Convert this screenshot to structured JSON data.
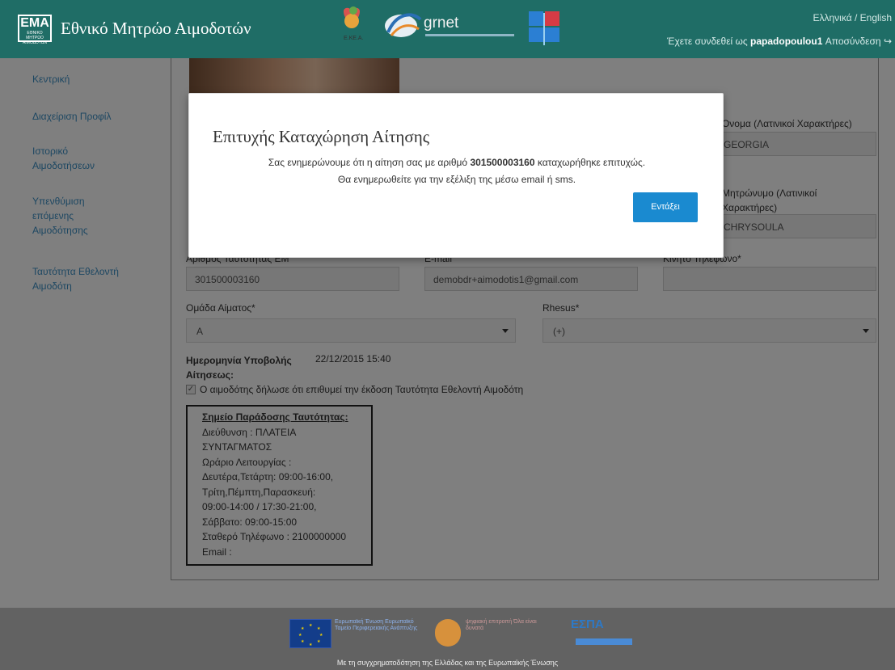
{
  "header": {
    "logo_text": "ΕΜΑ",
    "logo_sub": "ΕΘΝΙΚΟ ΜΗΤΡΩΟ ΑΙΜΟΔΟΤΩΝ",
    "title": "Εθνικό Μητρώο Αιμοδοτών",
    "partner_ekea": "Ε.ΚΕ.Α.",
    "partner_grnet": "grnet",
    "language_switch": "Ελληνικά / English",
    "logged_in_prefix": "Έχετε συνδεθεί ως",
    "username": "papadopoulou1",
    "logout_label": "Αποσύνδεση"
  },
  "sidebar": {
    "items": [
      {
        "label": "Κεντρική"
      },
      {
        "label": "Διαχείριση Προφίλ"
      },
      {
        "label": "Ιστορικό Αιμοδοτήσεων"
      },
      {
        "label": "Υπενθύμιση επόμενης Αιμοδότησης"
      },
      {
        "label": "Ταυτότητα Εθελοντή Αιμοδότη"
      }
    ]
  },
  "form": {
    "first_name_latin_label": "Όνομα (Λατινικοί Χαρακτήρες)",
    "first_name_latin_value": "GEORGIA",
    "patronymic_latin_label": "Μητρώνυμο (Λατινικοί Χαρακτήρες)",
    "patronymic_latin_value": "CHRYSOULA",
    "id_number_label": "Αριθμός Ταυτότητας ΕΜ",
    "id_number_value": "301500003160",
    "email_label": "E-mail",
    "email_value": "demobdr+aimodotis1@gmail.com",
    "mobile_label": "Κινητό Τηλέφωνο*",
    "mobile_value": "",
    "blood_group_label": "Ομάδα Αίματος*",
    "blood_group_value": "A",
    "rhesus_label": "Rhesus*",
    "rhesus_value": "(+)",
    "submission_date_label": "Ημερομηνία Υποβολής Αίτησεως:",
    "submission_date_value": "22/12/2015 15:40",
    "consent_checkbox_checked": true,
    "consent_text": "Ο αιμοδότης δήλωσε ότι επιθυμεί την έκδοση Ταυτότητα Εθελοντή Αιμοδότη"
  },
  "delivery_point": {
    "title": "Σημείο Παράδοσης Ταυτότητας:",
    "lines": [
      "Διεύθυνση : ΠΛΑΤΕΙΑ",
      "ΣΥΝΤΑΓΜΑΤΟΣ",
      "Ωράριο Λειτουργίας :",
      "Δευτέρα,Τετάρτη: 09:00-16:00,",
      "Τρίτη,Πέμπτη,Παρασκευή:",
      "09:00-14:00 / 17:30-21:00,",
      "Σάββατο: 09:00-15:00",
      "Σταθερό Τηλέφωνο : 2100000000",
      "Email :"
    ]
  },
  "modal": {
    "title": "Επιτυχής Καταχώρηση Αίτησης",
    "line1_prefix": "Σας ενημερώνουμε ότι η αίτηση σας με αριθμό",
    "line1_number": "301500003160",
    "line1_suffix": "καταχωρήθηκε επιτυχώς.",
    "line2": "Θα ενημερωθείτε για την εξέλιξη της μέσω email ή sms.",
    "ok_button": "Εντάξει"
  },
  "footer": {
    "eu_text": "Ευρωπαϊκή Ένωση Ευρωπαϊκό Ταμείο Περιφερειακής Ανάπτυξης",
    "digital_text": "ψηφιακή επιτροπή Όλα είναι δυνατά",
    "espa_text": "ΕΣΠΑ",
    "caption": "Με τη συγχρηματοδότηση της Ελλάδας και της Ευρωπαϊκής Ένωσης"
  },
  "colors": {
    "header_bg": "#1f6d66",
    "link": "#3b8fc5",
    "primary_button": "#1a8ad0",
    "footer_bg": "#626262"
  }
}
